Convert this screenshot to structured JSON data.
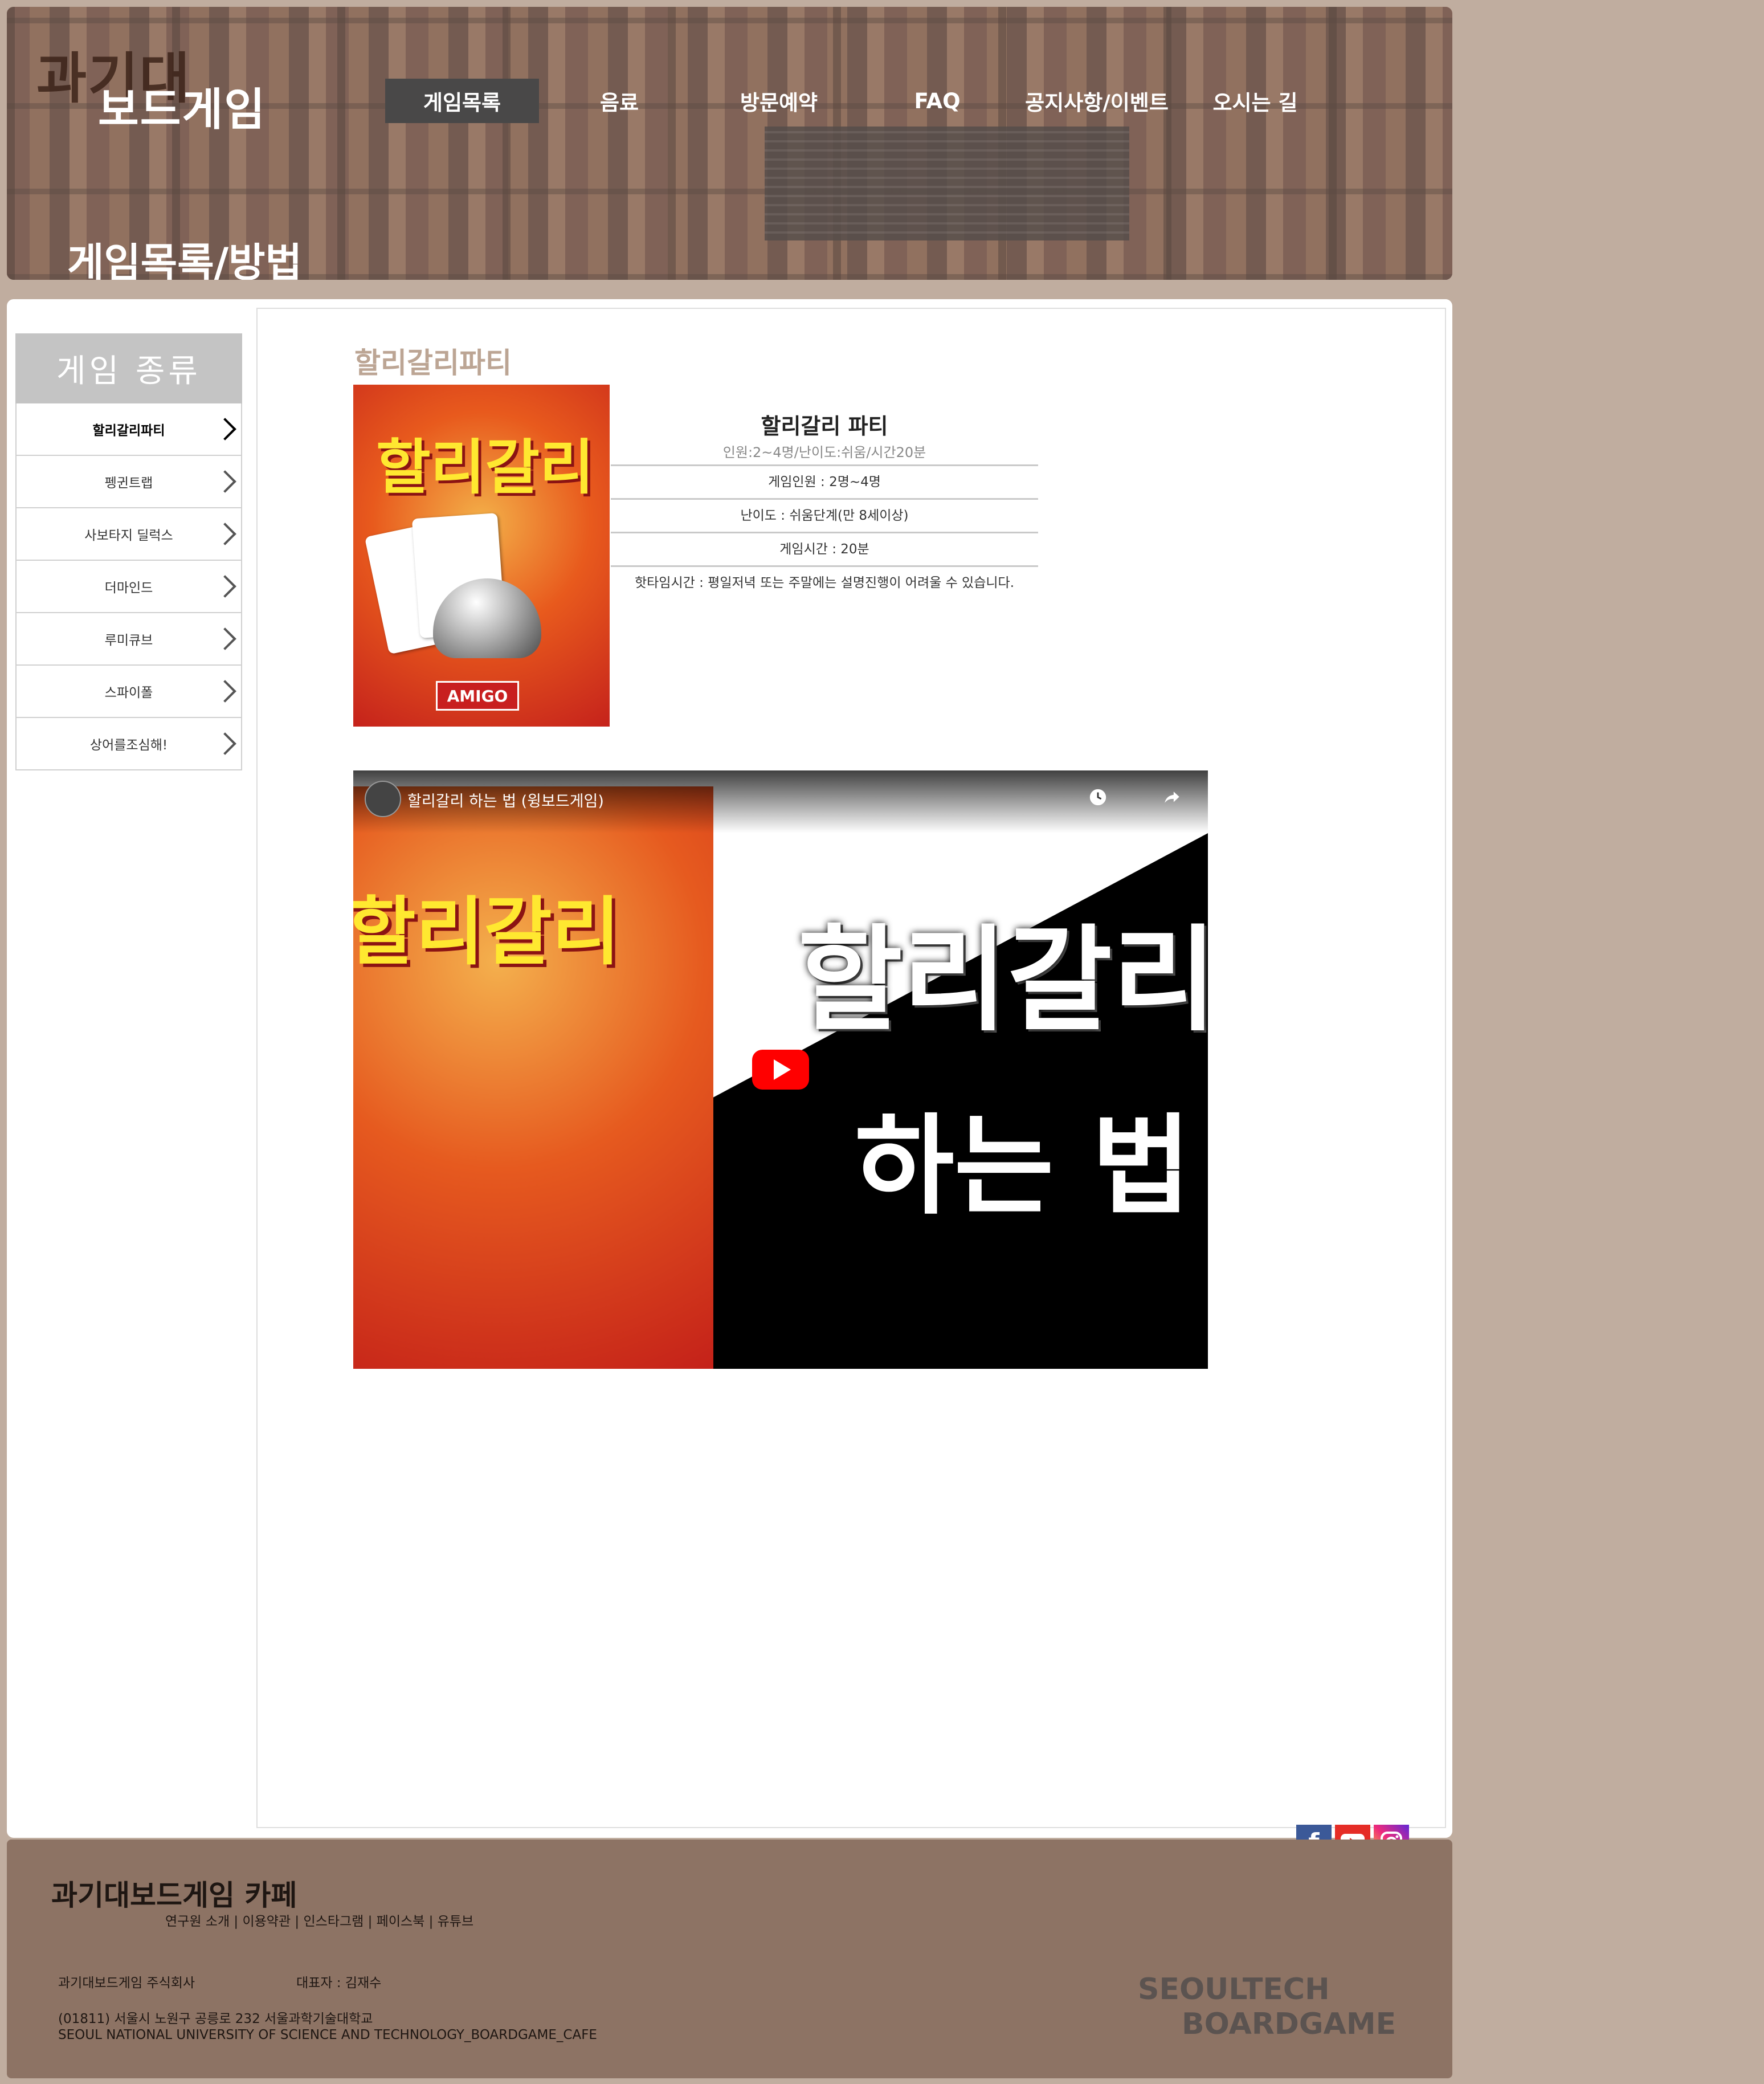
{
  "header": {
    "logo_line1": "과기대",
    "logo_line2": "보드게임",
    "nav": [
      "게임목록",
      "음료",
      "방문예약",
      "FAQ",
      "공지사항/이벤트",
      "오시는 길"
    ],
    "page_heading": "게임목록/방법"
  },
  "sidebar": {
    "title": "게임 종류",
    "items": [
      "할리갈리파티",
      "펭귄트랩",
      "사보타지 딜럭스",
      "더마인드",
      "루미큐브",
      "스파이폴",
      "상어를조심해!"
    ],
    "active_index": 0
  },
  "game": {
    "title": "할리갈리파티",
    "box_text": "할리갈리",
    "box_brand": "AMIGO",
    "name": "할리갈리 파티",
    "summary": "인원:2~4명/난이도:쉬움/시간20분",
    "players": "게임인원 : 2명~4명",
    "difficulty": "난이도 : 쉬움단계(만 8세이상)",
    "time": "게임시간 : 20분",
    "note": "핫타임시간 : 평일저녁 또는 주말에는 설명진행이 어려울 수 있습니다."
  },
  "video": {
    "title": "할리갈리 하는 법 (윙보드게임)",
    "thumb_text": "할리갈리",
    "big_title": "할리갈리",
    "big_sub": "하는 법",
    "watch_later": "나중에 보기",
    "share": "공유"
  },
  "social": {
    "icons": [
      "facebook-icon",
      "youtube-icon",
      "instagram-icon"
    ]
  },
  "footer": {
    "title": "과기대보드게임 카페",
    "links": "연구원 소개 | 이용약관 | 인스타그램 | 페이스북 | 유튜브",
    "company": "과기대보드게임 주식회사",
    "representative": "대표자 : 김재수",
    "address": "(01811) 서울시 노원구 공릉로 232 서울과학기술대학교",
    "english": "SEOUL NATIONAL UNIVERSITY OF SCIENCE AND TECHNOLOGY_BOARDGAME_CAFE",
    "brand_line1": "SEOULTECH",
    "brand_line2": "BOARDGAME"
  },
  "colors": {
    "page_bg": "#c0ad9f",
    "footer_bg": "#8d7364",
    "title_accent": "#bca594",
    "nav_active": "#494848"
  }
}
